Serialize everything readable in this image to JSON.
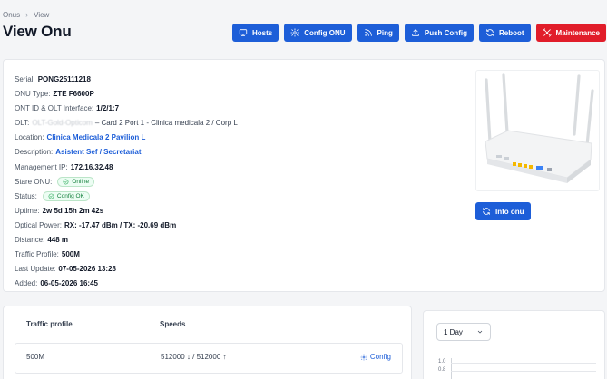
{
  "breadcrumb": {
    "parent": "Onus",
    "current": "View"
  },
  "page_title": "View Onu",
  "actions": [
    {
      "label": "Hosts",
      "icon": "monitor-icon",
      "color": "#1d5ed8"
    },
    {
      "label": "Config ONU",
      "icon": "gear-icon",
      "color": "#1d5ed8"
    },
    {
      "label": "Ping",
      "icon": "rss-icon",
      "color": "#1d5ed8"
    },
    {
      "label": "Push Config",
      "icon": "upload-icon",
      "color": "#1d5ed8"
    },
    {
      "label": "Reboot",
      "icon": "refresh-icon",
      "color": "#1d5ed8"
    },
    {
      "label": "Maintenance",
      "icon": "tools-icon",
      "color": "#e11d2a"
    }
  ],
  "details": {
    "serial": {
      "label": "Serial:",
      "value": "PONG25111218"
    },
    "onu_type": {
      "label": "ONU Type:",
      "value": "ZTE F6600P"
    },
    "ont_id": {
      "label": "ONT ID & OLT Interface:",
      "value": "1/2/1:7"
    },
    "olt": {
      "label": "OLT:",
      "value_obscured": "OLT-Gold-Opticom",
      "value": "– Card 2 Port 1 - Clinica medicala 2 / Corp L"
    },
    "location": {
      "label": "Location:",
      "value": "Clinica Medicala 2 Pavilion L"
    },
    "description": {
      "label": "Description:",
      "value": "Asistent Sef / Secretariat"
    },
    "management_ip": {
      "label": "Management IP:",
      "value": "172.16.32.48"
    },
    "stare_onu": {
      "label": "Stare ONU:",
      "badge": "Online"
    },
    "status": {
      "label": "Status:",
      "badge": "Config OK"
    },
    "uptime": {
      "label": "Uptime:",
      "value": "2w 5d 15h 2m 42s"
    },
    "optical_power": {
      "label": "Optical Power:",
      "value": "RX: -17.47 dBm / TX: -20.69 dBm"
    },
    "distance": {
      "label": "Distance:",
      "value": "448 m"
    },
    "traffic_profile": {
      "label": "Traffic Profile:",
      "value": "500M"
    },
    "last_update": {
      "label": "Last Update:",
      "value": "07-05-2026 13:28"
    },
    "added": {
      "label": "Added:",
      "value": "06-05-2026 16:45"
    }
  },
  "info_button": {
    "label": "Info onu",
    "icon": "refresh-icon"
  },
  "traffic_table": {
    "headers": [
      "Traffic profile",
      "Speeds"
    ],
    "rows": [
      {
        "profile": "500M",
        "speeds": "512000 ↓ / 512000 ↑",
        "action": "Config"
      }
    ]
  },
  "graph": {
    "period": "1 Day",
    "y_ticks": [
      "1.0",
      "0.8"
    ]
  },
  "colors": {
    "primary": "#1d5ed8",
    "danger": "#e11d2a",
    "success": "#15803d"
  }
}
